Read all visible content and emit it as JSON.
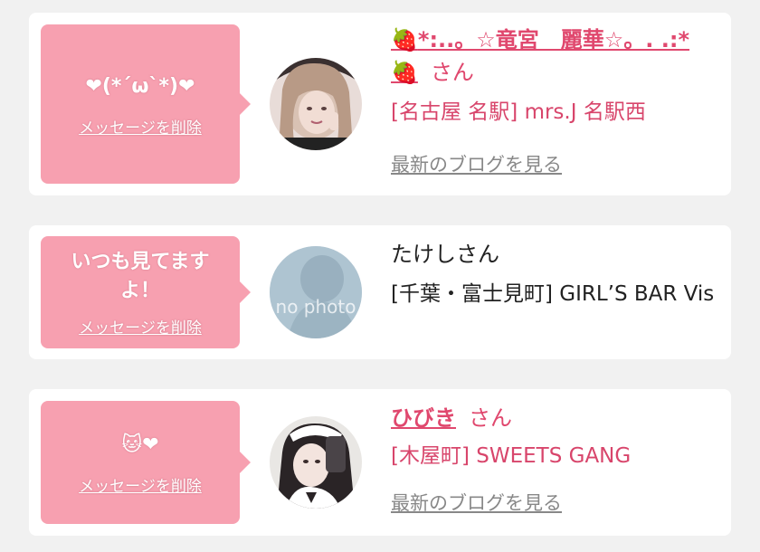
{
  "cards": [
    {
      "message": "❤(*´ω`*)❤",
      "delete_label": "メッセージを削除",
      "name_prefix": "🍓",
      "name": "*:..。☆竜宮　麗華☆。. .:*",
      "name_suffix": "🍓",
      "san": "さん",
      "shop": "[名古屋 名駅] mrs.J 名駅西",
      "blog_label": "最新のブログを見る"
    },
    {
      "message": "いつも見てますよ！",
      "delete_label": "メッセージを削除",
      "name": "たけしさん",
      "shop": "[千葉・富士見町] GIRL’S BAR Vis",
      "avatar_text": "no photo"
    },
    {
      "message": "🐱❤",
      "delete_label": "メッセージを削除",
      "name": "ひびき",
      "san": "さん",
      "shop": "[木屋町] SWEETS GANG",
      "blog_label": "最新のブログを見る"
    }
  ],
  "colors": {
    "bubble": "#f7a0b0",
    "accent": "#e0486e",
    "background": "#f1f1f1"
  }
}
